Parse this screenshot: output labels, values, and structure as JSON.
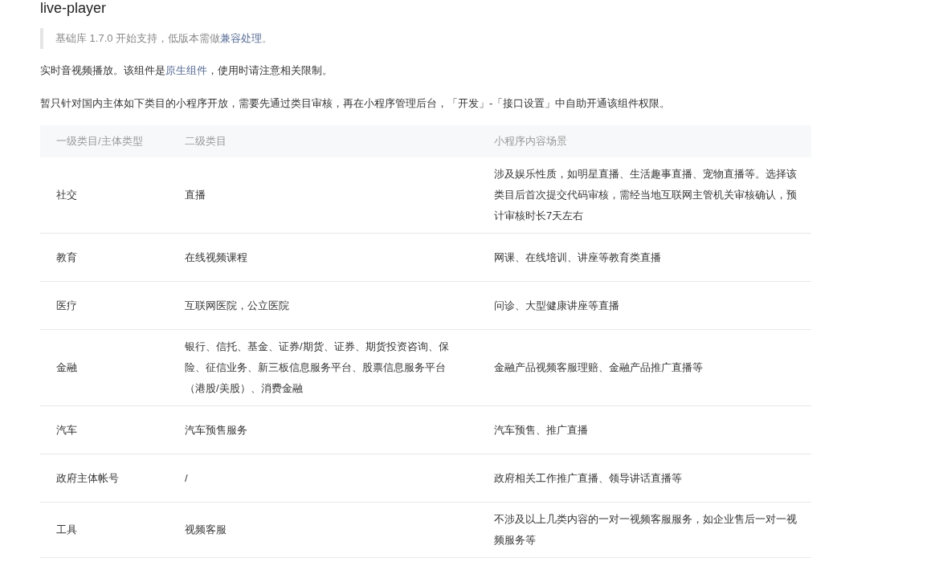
{
  "title": "live-player",
  "note": {
    "before": "基础库 1.7.0 开始支持，低版本需做",
    "link": "兼容处理",
    "after": "。"
  },
  "intro": {
    "before": "实时音视频播放。该组件是",
    "link": "原生组件",
    "after": "，使用时请注意相关限制。"
  },
  "notice": "暂只针对国内主体如下类目的小程序开放，需要先通过类目审核，再在小程序管理后台，「开发」-「接口设置」中自助开通该组件权限。",
  "table": {
    "columns": [
      "一级类目/主体类型",
      "二级类目",
      "小程序内容场景"
    ],
    "rows": [
      [
        "社交",
        "直播",
        "涉及娱乐性质，如明星直播、生活趣事直播、宠物直播等。选择该类目后首次提交代码审核，需经当地互联网主管机关审核确认，预计审核时长7天左右"
      ],
      [
        "教育",
        "在线视频课程",
        "网课、在线培训、讲座等教育类直播"
      ],
      [
        "医疗",
        "互联网医院，公立医院",
        "问诊、大型健康讲座等直播"
      ],
      [
        "金融",
        "银行、信托、基金、证券/期货、证券、期货投资咨询、保险、征信业务、新三板信息服务平台、股票信息服务平台（港股/美股）、消费金融",
        "金融产品视频客服理赔、金融产品推广直播等"
      ],
      [
        "汽车",
        "汽车预售服务",
        "汽车预售、推广直播"
      ],
      [
        "政府主体帐号",
        "/",
        "政府相关工作推广直播、领导讲话直播等"
      ],
      [
        "工具",
        "视频客服",
        "不涉及以上几类内容的一对一视频客服服务，如企业售后一对一视频服务等"
      ]
    ]
  }
}
